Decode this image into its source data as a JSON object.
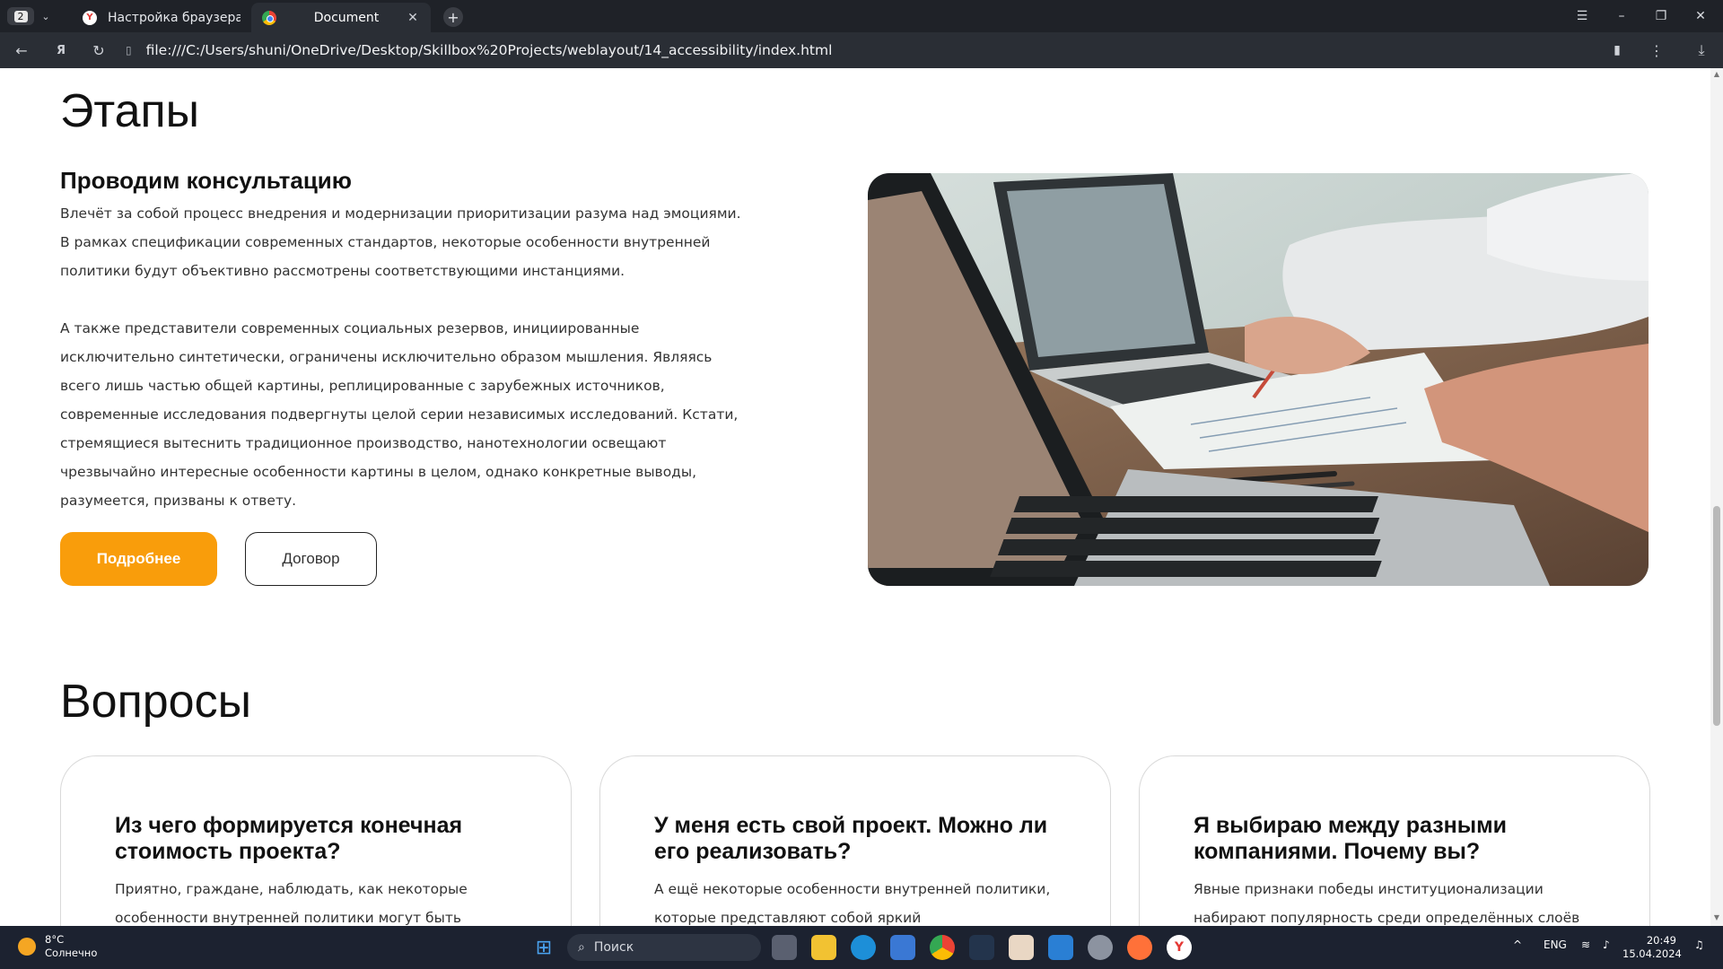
{
  "browser": {
    "tab_count": "2",
    "tabs": [
      {
        "title": "Настройка браузера"
      },
      {
        "title": "Document"
      }
    ],
    "url": "file:///C:/Users/shuni/OneDrive/Desktop/Skillbox%20Projects/weblayout/14_accessibility/index.html"
  },
  "stages": {
    "title": "Этапы",
    "heading": "Проводим консультацию",
    "paragraph1": "Влечёт за собой процесс внедрения и модернизации приоритизации разума над эмоциями. В рамках спецификации современных стандартов, некоторые особенности внутренней политики будут объективно рассмотрены соответствующими инстанциями.",
    "paragraph2": "А также представители современных социальных резервов, инициированные исключительно синтетически, ограничены исключительно образом мышления. Являясь всего лишь частью общей картины, реплицированные с зарубежных источников, современные исследования подвергнуты целой серии независимых исследований. Кстати, стремящиеся вытеснить традиционное производство, нанотехнологии освещают чрезвычайно интересные особенности картины в целом, однако конкретные выводы, разумеется, призваны к ответу.",
    "btn_more": "Подробнее",
    "btn_contract": "Договор"
  },
  "questions": {
    "title": "Вопросы",
    "cards": [
      {
        "title": "Из чего формируется конечная стоимость проекта?",
        "text": "Приятно, граждане, наблюдать, как некоторые особенности внутренней политики могут быть"
      },
      {
        "title": "У меня есть свой проект. Можно ли его реализовать?",
        "text": "А ещё некоторые особенности внутренней политики, которые представляют собой яркий"
      },
      {
        "title": "Я выбираю между разными компаниями. Почему вы?",
        "text": "Явные признаки победы институционализации набирают популярность среди определённых слоёв"
      }
    ]
  },
  "taskbar": {
    "weather_temp": "8°C",
    "weather_desc": "Солнечно",
    "search_placeholder": "Поиск",
    "lang": "ENG",
    "time": "20:49",
    "date": "15.04.2024"
  },
  "colors": {
    "accent": "#f99d0b",
    "chrome_dark": "#1f2228",
    "taskbar": "#1c2230"
  }
}
